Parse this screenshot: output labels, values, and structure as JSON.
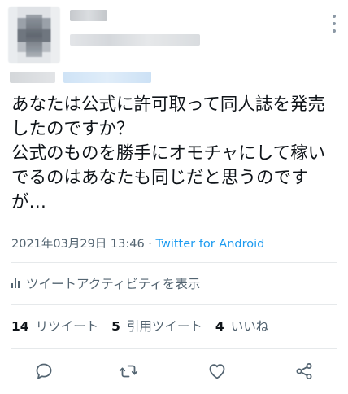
{
  "tweet": {
    "text": "あなたは公式に許可取って同人誌を発売したのですか？\n公式のものを勝手にオモチャにして稼いでるのはあなたも同じだと思うのですが…",
    "timestamp": "2021年03月29日 13:46",
    "separator": " · ",
    "client": "Twitter for Android"
  },
  "activity": {
    "label": "ツイートアクティビティを表示"
  },
  "stats": {
    "retweets_count": "14",
    "retweets_label": "リツイート",
    "quotes_count": "5",
    "quotes_label": "引用ツイート",
    "likes_count": "4",
    "likes_label": "いいね"
  },
  "colors": {
    "accent": "#1d9bf0",
    "secondary_text": "#536471",
    "divider": "#e6e9eb"
  },
  "icons": [
    "more-vertical-icon",
    "activity-bars-icon",
    "reply-icon",
    "retweet-icon",
    "like-icon",
    "share-icon"
  ]
}
